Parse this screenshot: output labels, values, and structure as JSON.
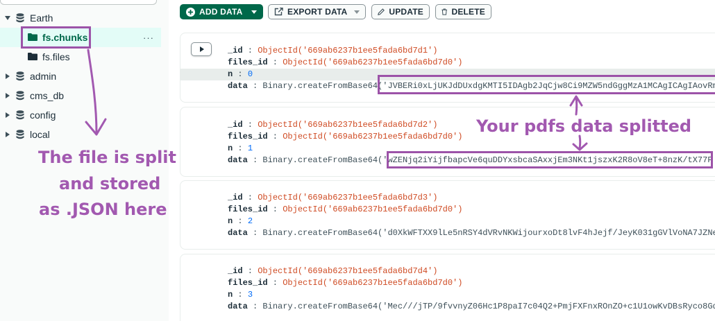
{
  "sidebar": {
    "databases": [
      {
        "label": "Earth",
        "expanded": true
      },
      {
        "label": "admin",
        "expanded": false
      },
      {
        "label": "cms_db",
        "expanded": false
      },
      {
        "label": "config",
        "expanded": false
      },
      {
        "label": "local",
        "expanded": false
      }
    ],
    "collections": [
      {
        "label": "fs.chunks",
        "selected": true,
        "more": "···"
      },
      {
        "label": "fs.files",
        "selected": false
      }
    ]
  },
  "toolbar": {
    "add_data": "ADD DATA",
    "export_data": "EXPORT DATA",
    "update": "UPDATE",
    "delete": "DELETE"
  },
  "documents": [
    {
      "id_key": "_id",
      "id_value": "ObjectId('669ab6237b1ee5fada6bd7d1')",
      "files_id_key": "files_id",
      "files_id_value": "ObjectId('669ab6237b1ee5fada6bd7d0')",
      "n_key": "n",
      "n_value": "0",
      "data_key": "data",
      "data_prefix": "Binary.createFromBase64(",
      "data_value": "'JVBERi0xLjUKJdDUxdgKMTI5IDAgb2JqCjw8Ci9MZW5ndGggMzA1MCAgICAgIAovRm"
    },
    {
      "id_key": "_id",
      "id_value": "ObjectId('669ab6237b1ee5fada6bd7d2')",
      "files_id_key": "files_id",
      "files_id_value": "ObjectId('669ab6237b1ee5fada6bd7d0')",
      "n_key": "n",
      "n_value": "1",
      "data_key": "data",
      "data_prefix": "Binary.createFromBase64(",
      "data_value": "'wZENjq2iYijfbapcVe6quDDYxsbcaSAxxjEm3NKt1jszxK2R8oV8eT+8nzK/tX77P"
    },
    {
      "id_key": "_id",
      "id_value": "ObjectId('669ab6237b1ee5fada6bd7d3')",
      "files_id_key": "files_id",
      "files_id_value": "ObjectId('669ab6237b1ee5fada6bd7d0')",
      "n_key": "n",
      "n_value": "2",
      "data_key": "data",
      "data_prefix": "Binary.createFromBase64(",
      "data_value": "'d0XkWFTXX9lLe5nRSY4dVRvNKWijourxoDt8lvF4hJejf/JeyK031gGVlVoNA7JZNe"
    },
    {
      "id_key": "_id",
      "id_value": "ObjectId('669ab6237b1ee5fada6bd7d4')",
      "files_id_key": "files_id",
      "files_id_value": "ObjectId('669ab6237b1ee5fada6bd7d0')",
      "n_key": "n",
      "n_value": "3",
      "data_key": "data",
      "data_prefix": "Binary.createFromBase64(",
      "data_value": "'Mec///jTP/9fvvnyZ06Hc1P8paI7c04Q2+PmjFXFnxROnZO+c1U1owKvDBsRyco8Gq"
    }
  ],
  "annotations": {
    "left_lines": [
      "The file is split",
      "and stored",
      "as .JSON here"
    ],
    "right_text": "Your pdfs data splitted"
  },
  "colors": {
    "accent_green": "#00684a",
    "annotation_purple": "#9c53a8",
    "objectid_orange": "#cf4a22",
    "number_blue": "#016bf8"
  }
}
